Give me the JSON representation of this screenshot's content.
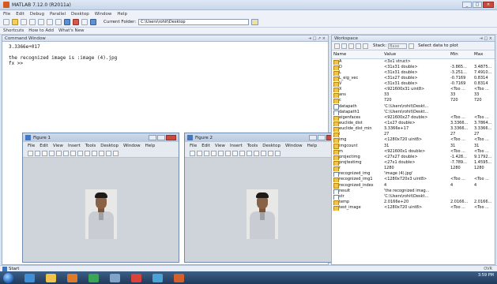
{
  "window": {
    "title": "MATLAB 7.12.0 (R2011a)"
  },
  "menu": [
    "File",
    "Edit",
    "Debug",
    "Parallel",
    "Desktop",
    "Window",
    "Help"
  ],
  "toolbar": {
    "current_folder_label": "Current Folder:",
    "current_folder_value": "C:\\Users\\rohit\\Desktop"
  },
  "shortcuts": [
    "Shortcuts",
    "How to Add",
    "What's New"
  ],
  "command_window": {
    "title": "Command Window",
    "lines": [
      "3.3366e+017",
      "",
      "the recognized image is :image (4).jpg",
      "fx >>"
    ]
  },
  "figure1": {
    "title": "Figure 1",
    "menu": [
      "File",
      "Edit",
      "View",
      "Insert",
      "Tools",
      "Desktop",
      "Window",
      "Help"
    ]
  },
  "figure2": {
    "title": "Figure 2",
    "menu": [
      "File",
      "Edit",
      "View",
      "Insert",
      "Tools",
      "Desktop",
      "Window",
      "Help"
    ]
  },
  "workspace": {
    "title": "Workspace",
    "stack_label": "Stack:",
    "stack_value": "Base",
    "plot_label": "Select data to plot",
    "columns": [
      "Name",
      "Value",
      "Min",
      "Max"
    ],
    "rows": [
      [
        "A",
        "<3x1 struct>",
        "",
        ""
      ],
      [
        "D",
        "<31x31 double>",
        "-3.865...",
        "3.4875..."
      ],
      [
        "L",
        "<31x31 double>",
        "-3.251...",
        "7.4910..."
      ],
      [
        "L_eig_vec",
        "<31x27 double>",
        "-0.7169",
        "0.8314"
      ],
      [
        "V",
        "<31x31 double>",
        "-0.7169",
        "0.8314"
      ],
      [
        "X",
        "<921600x31 uint8>",
        "<Too ...",
        "<Too ..."
      ],
      [
        "ans",
        "33",
        "33",
        "33"
      ],
      [
        "c",
        "720",
        "720",
        "720"
      ],
      [
        "datapath",
        "'C:\\Users\\rohit\\Deskt...",
        "",
        ""
      ],
      [
        "datapath1",
        "'C:\\Users\\rohit\\Deskt...",
        "",
        ""
      ],
      [
        "eigenfaces",
        "<921600x27 double>",
        "<Too ...",
        "<Too ..."
      ],
      [
        "euclide_dist",
        "<1x27 double>",
        "3.3366...",
        "3.7864..."
      ],
      [
        "euclide_dist_min",
        "3.3366e+17",
        "3.3366...",
        "3.3366..."
      ],
      [
        "i",
        "27",
        "27",
        "27"
      ],
      [
        "img",
        "<1280x720 uint8>",
        "<Too ...",
        "<Too ..."
      ],
      [
        "imgcount",
        "31",
        "31",
        "31"
      ],
      [
        "m",
        "<921600x1 double>",
        "<Too ...",
        "<Too ..."
      ],
      [
        "projectimg",
        "<27x27 double>",
        "-1.428...",
        "9.1792..."
      ],
      [
        "projtestimg",
        "<27x1 double>",
        "-7.789...",
        "1.4595..."
      ],
      [
        "r",
        "1280",
        "1280",
        "1280"
      ],
      [
        "recognized_img",
        "'image (4).jpg'",
        "",
        ""
      ],
      [
        "recognized_img1",
        "<1280x720x3 uint8>",
        "<Too ...",
        "<Too ..."
      ],
      [
        "recognized_index",
        "4",
        "4",
        "4"
      ],
      [
        "result",
        "'the recognized imag...",
        "",
        ""
      ],
      [
        "str",
        "'C:\\Users\\rohit\\Deskt...",
        "",
        ""
      ],
      [
        "temp",
        "2.0166e+20",
        "2.0166...",
        "2.0166..."
      ],
      [
        "test_image",
        "<1280x720 uint8>",
        "<Too ...",
        "<Too ..."
      ]
    ]
  },
  "start_button": "Start",
  "status_right": "OVR",
  "tray": {
    "time": "3:59 PM"
  }
}
